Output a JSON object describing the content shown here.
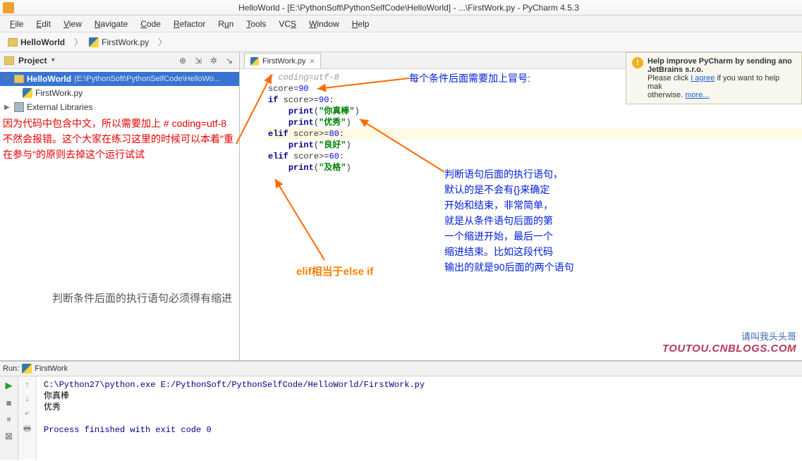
{
  "title_bar": "HelloWorld - [E:\\PythonSoft\\PythonSelfCode\\HelloWorld] - ...\\FirstWork.py - PyCharm 4.5.3",
  "menu": {
    "file": "File",
    "edit": "Edit",
    "view": "View",
    "navigate": "Navigate",
    "code": "Code",
    "refactor": "Refactor",
    "run": "Run",
    "tools": "Tools",
    "vcs": "VCS",
    "window": "Window",
    "help": "Help"
  },
  "breadcrumb": {
    "root": "HelloWorld",
    "file": "FirstWork.py"
  },
  "project_panel": {
    "title": "Project",
    "tree": {
      "root_name": "HelloWorld",
      "root_path": "(E:\\PythonSoft\\PythonSelfCode\\HelloWo...",
      "file": "FirstWork.py",
      "ext_libs": "External Libraries"
    }
  },
  "editor_tab": "FirstWork.py",
  "code_lines": [
    {
      "raw": "# coding=utf-8",
      "cls": "cmt"
    },
    {
      "k": "",
      "t": "score",
      "op": "=",
      "v": "90"
    },
    {
      "k": "if ",
      "t": "score",
      "op": ">=",
      "v": "90",
      ":": ":"
    },
    {
      "indent": "    ",
      "fn": "print",
      "arg": "\"你真棒\""
    },
    {
      "indent": "    ",
      "fn": "print",
      "arg": "\"优秀\""
    },
    {
      "k": "elif ",
      "t": "score",
      "op": ">=",
      "v": "80",
      ":": ":"
    },
    {
      "indent": "    ",
      "fn": "print",
      "arg": "\"良好\""
    },
    {
      "k": "elif ",
      "t": "score",
      "op": ">=",
      "v": "60",
      ":": ":"
    },
    {
      "indent": "    ",
      "fn": "print",
      "arg": "\"及格\""
    }
  ],
  "annotations": {
    "red": "因为代码中包含中文，所以需要加上 # coding=utf-8 不然会报错。这个大家在练习这里的时候可以本着\"重在参与\"的原则去掉这个运行试试",
    "gray": "判断条件后面的执行语句必须得有缩进",
    "blue_top": "每个条件后面需要加上冒号:",
    "blue_right": "判断语句后面的执行语句，\n默认的是不会有{}来确定\n开始和结束，非常简单，\n就是从条件语句后面的第\n一个缩进开始，最后一个\n缩进结束。比如这段代码\n输出的就是90后面的两个语句",
    "orange": "elif相当于else if"
  },
  "watermark": {
    "l1": "请叫我头头哥",
    "l2": "TOUTOU.CNBLOGS.COM"
  },
  "notification": {
    "title": "Help improve PyCharm by sending ano",
    "sub": "JetBrains s.r.o.",
    "pre": "Please click ",
    "link": "I agree",
    "post": " if you want to help mak",
    "otherwise": "otherwise. ",
    "more": "more..."
  },
  "run_tab": {
    "label": "Run:",
    "name": "FirstWork"
  },
  "console": {
    "cmd": "C:\\Python27\\python.exe E:/PythonSoft/PythonSelfCode/HelloWorld/FirstWork.py",
    "o1": "你真棒",
    "o2": "优秀",
    "exit": "Process finished with exit code 0"
  }
}
